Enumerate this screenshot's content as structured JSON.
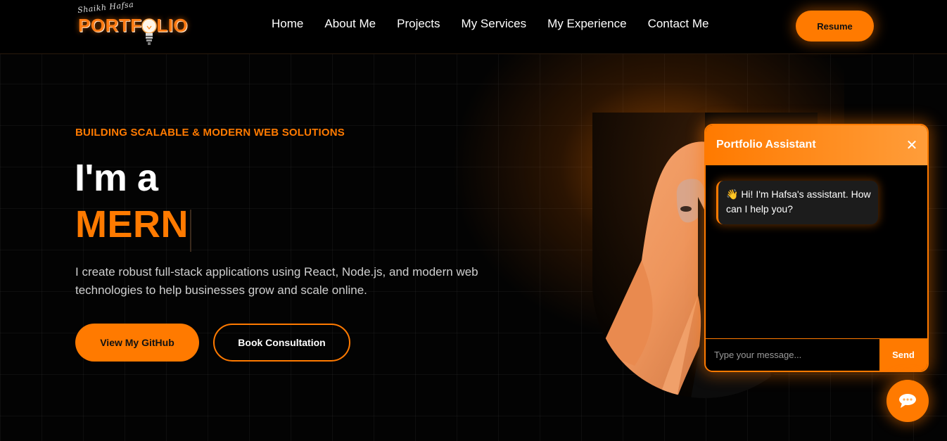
{
  "brand": {
    "logo_script": "Shaikh Hafsa",
    "logo_word": "PORTFOLIO",
    "accent": "#ff7a00"
  },
  "nav": {
    "items": [
      {
        "label": "Home"
      },
      {
        "label": "About Me"
      },
      {
        "label": "Projects"
      },
      {
        "label": "My Services"
      },
      {
        "label": "My Experience"
      },
      {
        "label": "Contact Me"
      }
    ],
    "resume_label": "Resume"
  },
  "hero": {
    "eyebrow": "BUILDING SCALABLE & MODERN WEB SOLUTIONS",
    "headline_prefix": "I'm a",
    "headline_highlight": "MERN",
    "description": "I create robust full-stack applications using React, Node.js, and modern web technologies to help businesses grow and scale online.",
    "primary_button": "View My GitHub",
    "secondary_button": "Book Consultation"
  },
  "chat": {
    "title": "Portfolio Assistant",
    "close_icon": "close-icon",
    "greeting": "👋 Hi! I'm Hafsa's assistant. How can I help you?",
    "input_placeholder": "Type your message...",
    "send_label": "Send",
    "fab_icon": "chat-bubble-icon"
  }
}
